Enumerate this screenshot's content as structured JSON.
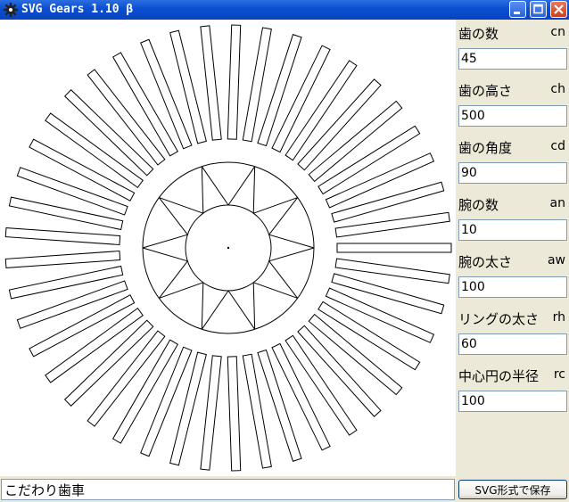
{
  "window": {
    "title": "SVG Gears 1.10 β"
  },
  "params": [
    {
      "label": "歯の数",
      "code": "cn",
      "value": "45"
    },
    {
      "label": "歯の高さ",
      "code": "ch",
      "value": "500"
    },
    {
      "label": "歯の角度",
      "code": "cd",
      "value": "90"
    },
    {
      "label": "腕の数",
      "code": "an",
      "value": "10"
    },
    {
      "label": "腕の太さ",
      "code": "aw",
      "value": "100"
    },
    {
      "label": "リングの太さ",
      "code": "rh",
      "value": "60"
    },
    {
      "label": "中心円の半径",
      "code": "rc",
      "value": "100"
    }
  ],
  "footer": {
    "name_value": "こだわり歯車",
    "save_label": "SVG形式で保存"
  },
  "icons": {
    "app": "gear-icon",
    "minimize": "minimize-icon",
    "maximize": "maximize-icon",
    "close": "close-icon"
  }
}
